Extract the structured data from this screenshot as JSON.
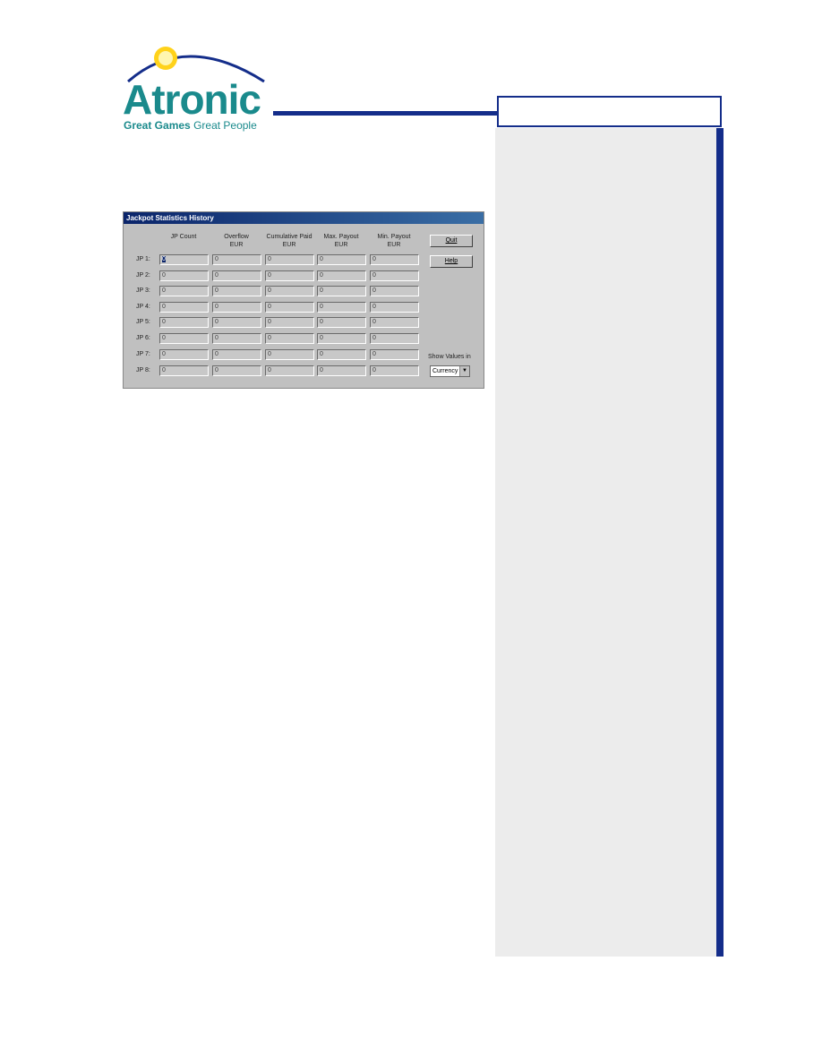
{
  "logo": {
    "brand": "Atronic",
    "tagline_bold": "Great Games",
    "tagline": "Great People"
  },
  "dialog": {
    "title": "Jackpot Statistics History",
    "columns": [
      [
        "",
        "JP Count"
      ],
      [
        "Overflow",
        "EUR"
      ],
      [
        "Cumulative Paid",
        "EUR"
      ],
      [
        "Max. Payout",
        "EUR"
      ],
      [
        "Min. Payout",
        "EUR"
      ]
    ],
    "rows": [
      {
        "label": "JP 1:",
        "values": [
          "0",
          "0",
          "0",
          "0",
          "0"
        ]
      },
      {
        "label": "JP 2:",
        "values": [
          "0",
          "0",
          "0",
          "0",
          "0"
        ]
      },
      {
        "label": "JP 3:",
        "values": [
          "0",
          "0",
          "0",
          "0",
          "0"
        ]
      },
      {
        "label": "JP 4:",
        "values": [
          "0",
          "0",
          "0",
          "0",
          "0"
        ]
      },
      {
        "label": "JP 5:",
        "values": [
          "0",
          "0",
          "0",
          "0",
          "0"
        ]
      },
      {
        "label": "JP 6:",
        "values": [
          "0",
          "0",
          "0",
          "0",
          "0"
        ]
      },
      {
        "label": "JP 7:",
        "values": [
          "0",
          "0",
          "0",
          "0",
          "0"
        ]
      },
      {
        "label": "JP 8:",
        "values": [
          "0",
          "0",
          "0",
          "0",
          "0"
        ]
      }
    ],
    "quit_label": "Quit",
    "help_label": "Help",
    "show_values_label": "Show Values in",
    "show_values_selected": "Currency"
  },
  "colors": {
    "brand_blue": "#142d8a",
    "logo_teal": "#1a8a8c",
    "dialog_bg": "#c0c0c0"
  }
}
